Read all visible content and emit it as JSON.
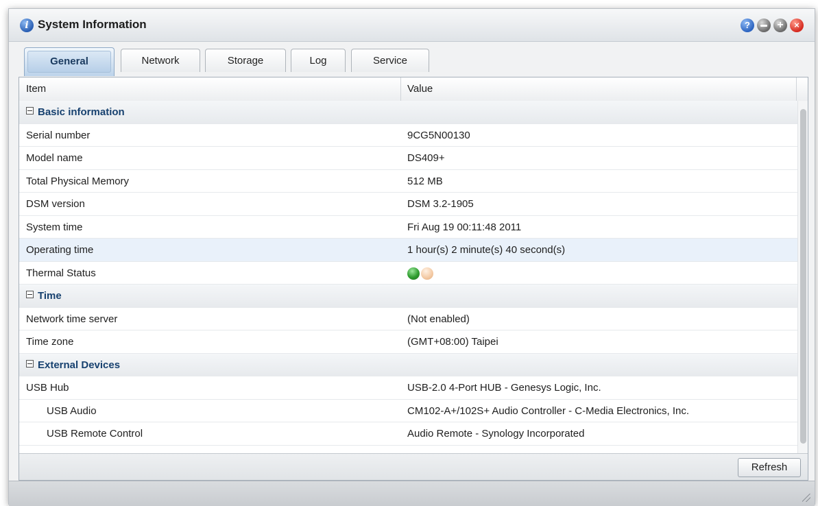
{
  "window": {
    "title": "System Information",
    "controls": {
      "help": "?",
      "close": "×",
      "maximize": "+"
    }
  },
  "tabs": [
    {
      "label": "General",
      "active": true
    },
    {
      "label": "Network",
      "active": false
    },
    {
      "label": "Storage",
      "active": false
    },
    {
      "label": "Log",
      "active": false
    },
    {
      "label": "Service",
      "active": false
    }
  ],
  "grid": {
    "columns": {
      "item": "Item",
      "value": "Value"
    },
    "groups": [
      {
        "title": "Basic information",
        "rows": [
          {
            "item": "Serial number",
            "value": "9CG5N00130"
          },
          {
            "item": "Model name",
            "value": "DS409+"
          },
          {
            "item": "Total Physical Memory",
            "value": "512 MB"
          },
          {
            "item": "DSM version",
            "value": "DSM 3.2-1905"
          },
          {
            "item": "System time",
            "value": "Fri Aug 19 00:11:48 2011"
          },
          {
            "item": "Operating time",
            "value": "1 hour(s) 2 minute(s) 40 second(s)"
          },
          {
            "item": "Thermal Status",
            "value": ""
          }
        ]
      },
      {
        "title": "Time",
        "rows": [
          {
            "item": "Network time server",
            "value": "(Not enabled)"
          },
          {
            "item": "Time zone",
            "value": "(GMT+08:00) Taipei"
          }
        ]
      },
      {
        "title": "External Devices",
        "rows": [
          {
            "item": "USB Hub",
            "value": "USB-2.0 4-Port HUB - Genesys Logic, Inc."
          },
          {
            "item": "USB Audio",
            "value": "CM102-A+/102S+ Audio Controller - C-Media Electronics, Inc."
          },
          {
            "item": "USB Remote Control",
            "value": "Audio Remote - Synology Incorporated"
          }
        ]
      }
    ]
  },
  "thermal_status": {
    "indicators": [
      "green",
      "peach"
    ],
    "green_color": "#2f9c2f",
    "peach_color": "#f3c9a3"
  },
  "footer": {
    "refresh_label": "Refresh"
  }
}
